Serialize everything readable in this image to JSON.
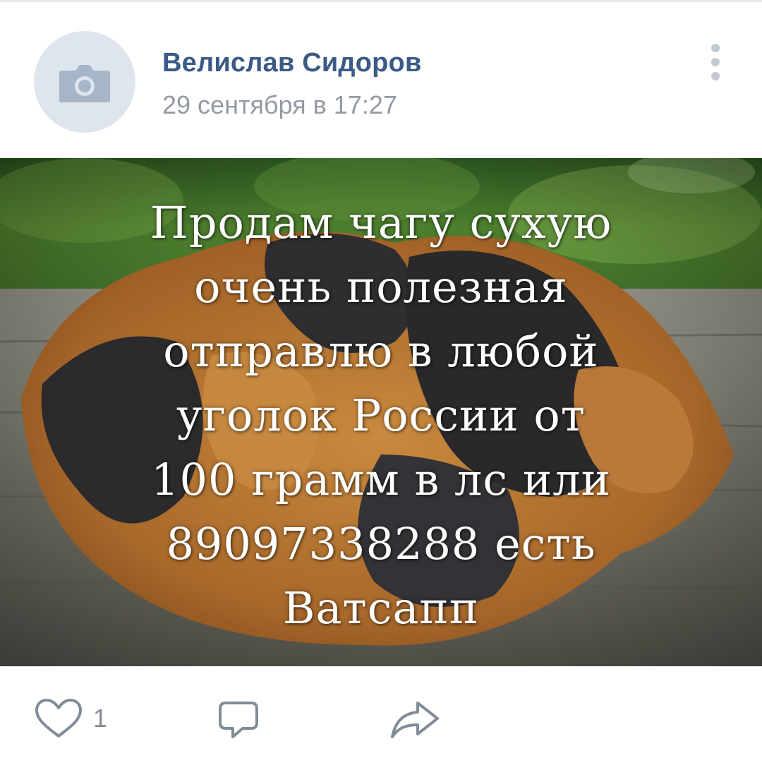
{
  "post": {
    "author": "Велислав Сидоров",
    "date": "29 сентября в 17:27",
    "image_text": "Продам чагу сухую\nочень полезная\nотправлю в любой\nуголок России от\n100 грамм в лс или\n89097338288 есть\nВатсапп",
    "likes": "1"
  },
  "icons": {
    "avatar": "camera-icon",
    "menu": "more-vertical-icon",
    "like": "heart-icon",
    "comment": "comment-icon",
    "share": "share-arrow-icon"
  },
  "colors": {
    "author": "#3b5b86",
    "meta": "#939aa3",
    "icon": "#818c99",
    "avatar_bg": "#dfe5ec"
  }
}
